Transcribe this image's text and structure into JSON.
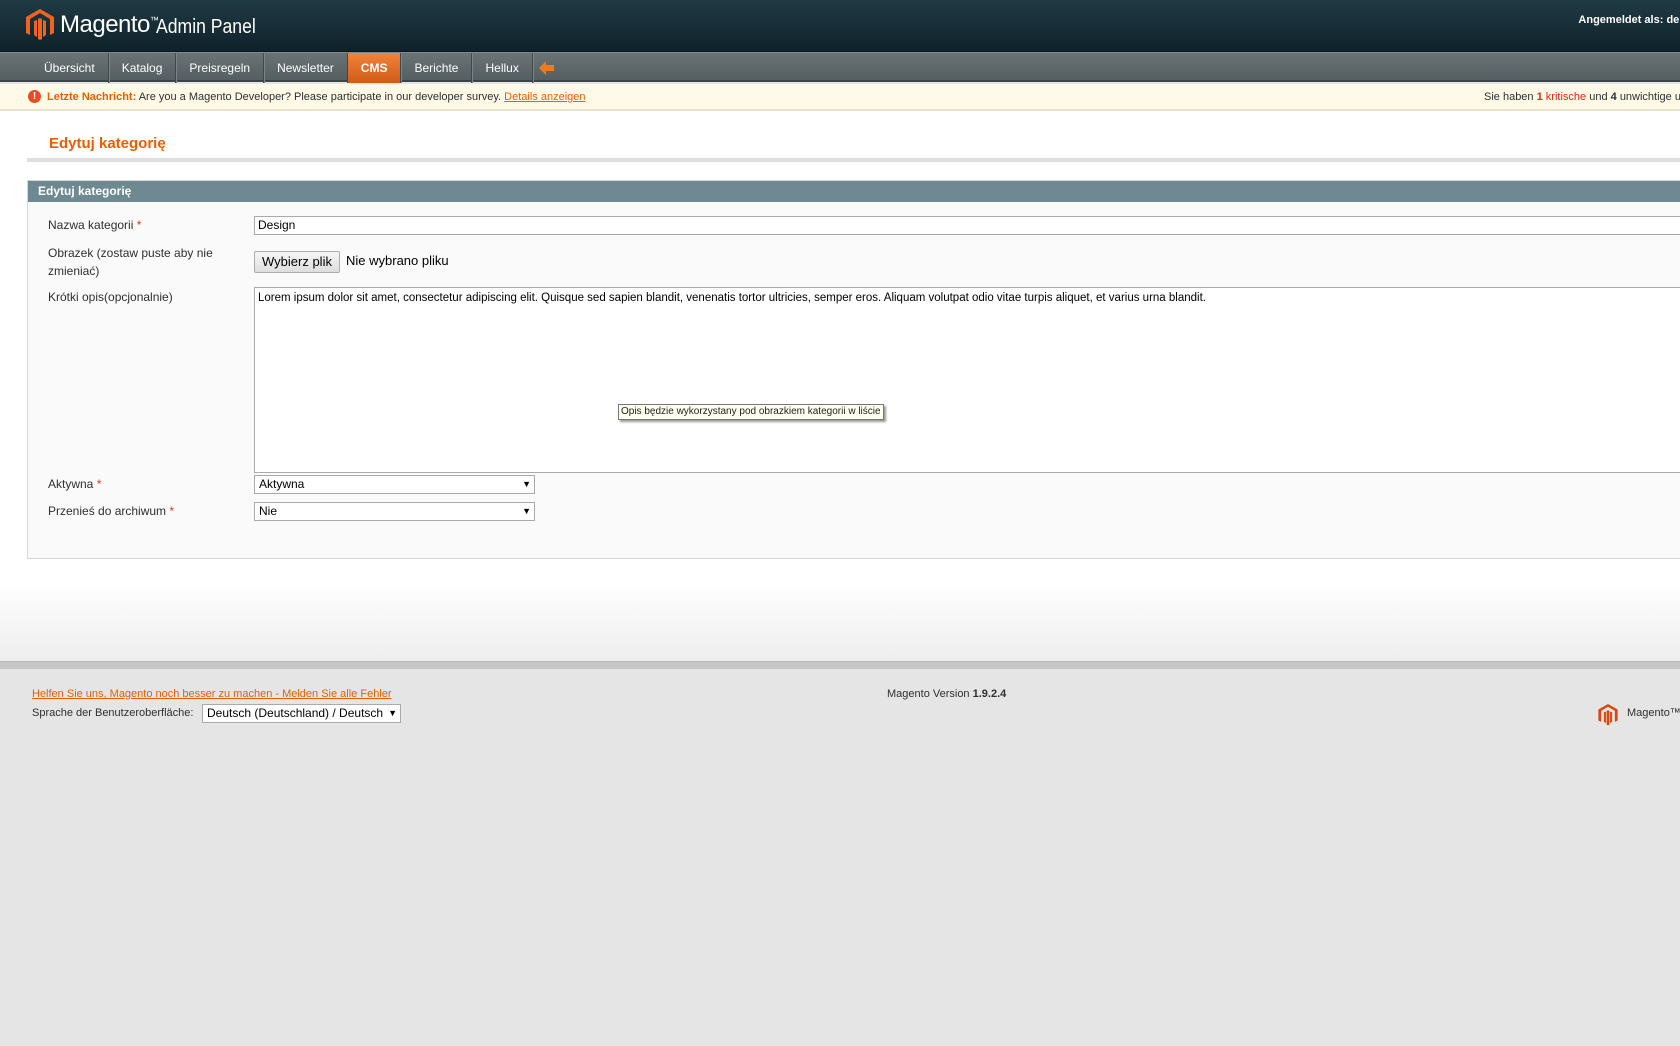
{
  "header": {
    "brand": "Magento",
    "brand_tm": "™",
    "subtitle": "Admin Panel",
    "logged_in": "Angemeldet als: den"
  },
  "nav": {
    "items": [
      {
        "label": "Übersicht"
      },
      {
        "label": "Katalog"
      },
      {
        "label": "Preisregeln"
      },
      {
        "label": "Newsletter"
      },
      {
        "label": "CMS",
        "active": true
      },
      {
        "label": "Berichte"
      },
      {
        "label": "Hellux"
      }
    ],
    "extra_icon": "arrow-left-icon"
  },
  "message": {
    "label": "Letzte Nachricht:",
    "text": "Are you a Magento Developer? Please participate in our developer survey.",
    "link": "Details anzeigen",
    "right_prefix": "Sie haben",
    "critical_count": "1",
    "critical_label": "kritische",
    "and": "und",
    "major_count": "4",
    "major_label": "unwichtige u"
  },
  "page": {
    "title": "Edytuj kategorię",
    "fieldset_title": "Edytuj kategorię"
  },
  "form": {
    "name_label": "Nazwa kategorii",
    "name_value": "Design",
    "image_label_1": "Obrazek (zostaw puste aby nie",
    "image_label_2": "zmieniać)",
    "file_button": "Wybierz plik",
    "file_status": "Nie wybrano pliku",
    "desc_label": "Krótki opis(opcjonalnie)",
    "desc_value": "Lorem ipsum dolor sit amet, consectetur adipiscing elit. Quisque sed sapien blandit, venenatis tortor ultricies, semper eros. Aliquam volutpat odio vitae turpis aliquet, et varius urna blandit.",
    "tooltip": "Opis będzie wykorzystany pod obrazkiem kategorii w liście",
    "active_label": "Aktywna",
    "active_value": "Aktywna",
    "archive_label": "Przenieś do archiwum",
    "archive_value": "Nie",
    "required_mark": "*"
  },
  "footer": {
    "help_link": "Helfen Sie uns, Magento noch besser zu machen - Melden Sie alle Fehler",
    "lang_label": "Sprache der Benutzeroberfläche:",
    "lang_value": "Deutsch (Deutschland) / Deutsch",
    "version_label": "Magento Version",
    "version": "1.9.2.4",
    "brand": "Magento™"
  },
  "colors": {
    "accent": "#eb5e00",
    "header_bg": "#13282f",
    "nav_bg": "#5f686b",
    "fieldset_head": "#6f8992"
  }
}
